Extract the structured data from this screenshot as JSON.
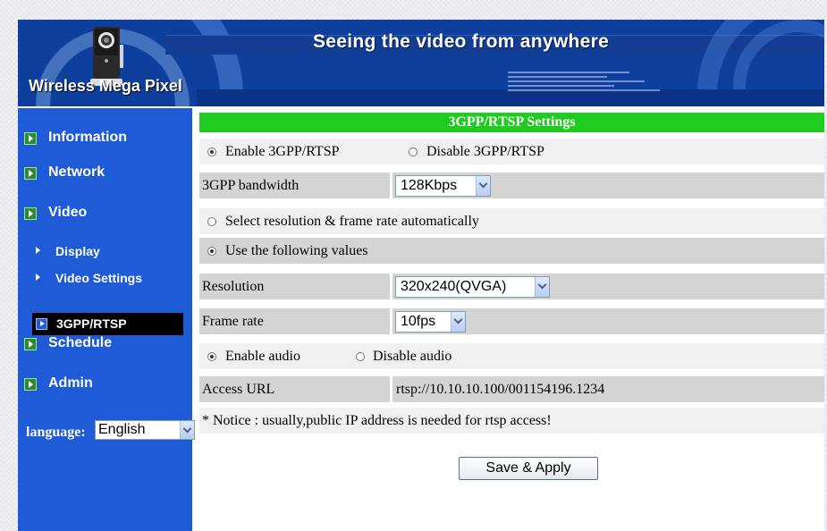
{
  "header": {
    "brand": "Wireless Mega Pixel",
    "slogan": "Seeing the video from anywhere"
  },
  "sidebar": {
    "items": [
      {
        "label": "Information"
      },
      {
        "label": "Network"
      },
      {
        "label": "Video"
      },
      {
        "label": "Schedule"
      },
      {
        "label": "Admin"
      }
    ],
    "video_sub": [
      {
        "label": "Display"
      },
      {
        "label": "Video Settings"
      },
      {
        "label": "3GPP/RTSP",
        "active": true
      }
    ],
    "language_label": "language:",
    "language_value": "English"
  },
  "main": {
    "title": "3GPP/RTSP Settings",
    "enable_label": "Enable 3GPP/RTSP",
    "disable_label": "Disable 3GPP/RTSP",
    "bandwidth_label": "3GPP bandwidth",
    "bandwidth_value": "128Kbps",
    "auto_label": "Select resolution & frame rate automatically",
    "manual_label": "Use the following values",
    "resolution_label": "Resolution",
    "resolution_value": "320x240(QVGA)",
    "framerate_label": "Frame rate",
    "framerate_value": "10fps",
    "enable_audio_label": "Enable audio",
    "disable_audio_label": "Disable audio",
    "access_url_label": "Access URL",
    "access_url_value": "rtsp://10.10.10.100/001154196.1234",
    "notice": "* Notice : usually,public IP address is needed for rtsp access!",
    "save_label": "Save & Apply"
  },
  "colors": {
    "sidebar": "#1f5ad7",
    "title_bar": "#1ecb1e",
    "header": "#0f3f9c",
    "cell": "#d4d4d4",
    "row": "#f0f0f0"
  }
}
